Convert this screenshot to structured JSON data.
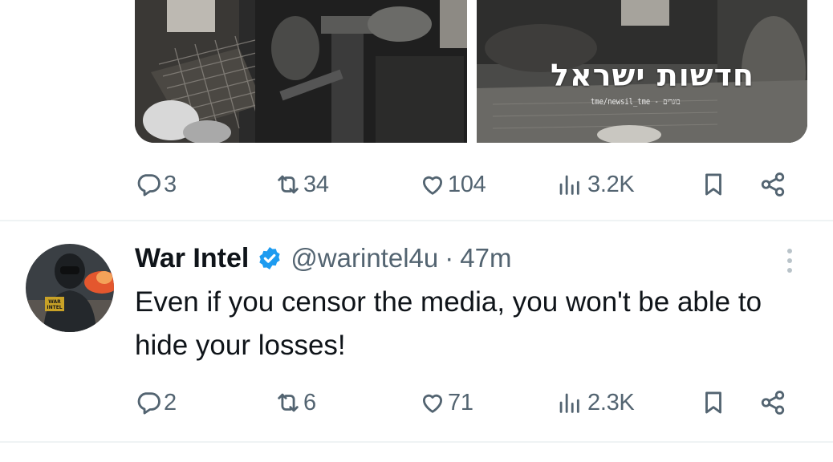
{
  "previous_tweet": {
    "media_watermark": {
      "title": "חדשות ישראל",
      "subtitle": "tme/newsil_tme - בוגרים"
    },
    "actions": {
      "replies": "3",
      "reposts": "34",
      "likes": "104",
      "views": "3.2K"
    }
  },
  "tweet": {
    "author_name": "War Intel",
    "verified": true,
    "handle": "@warintel4u",
    "separator": "·",
    "time": "47m",
    "text": "Even if you censor the media, you won't be able to hide your losses!",
    "avatar_text": "WAR INTEL",
    "actions": {
      "replies": "2",
      "reposts": "6",
      "likes": "71",
      "views": "2.3K"
    }
  },
  "colors": {
    "text_primary": "#0f1419",
    "text_secondary": "#536471",
    "verified_blue": "#1d9bf0",
    "divider": "#eff3f4"
  },
  "icons": [
    "reply-icon",
    "repost-icon",
    "like-icon",
    "views-icon",
    "bookmark-icon",
    "share-icon",
    "verified-badge-icon",
    "more-icon"
  ]
}
